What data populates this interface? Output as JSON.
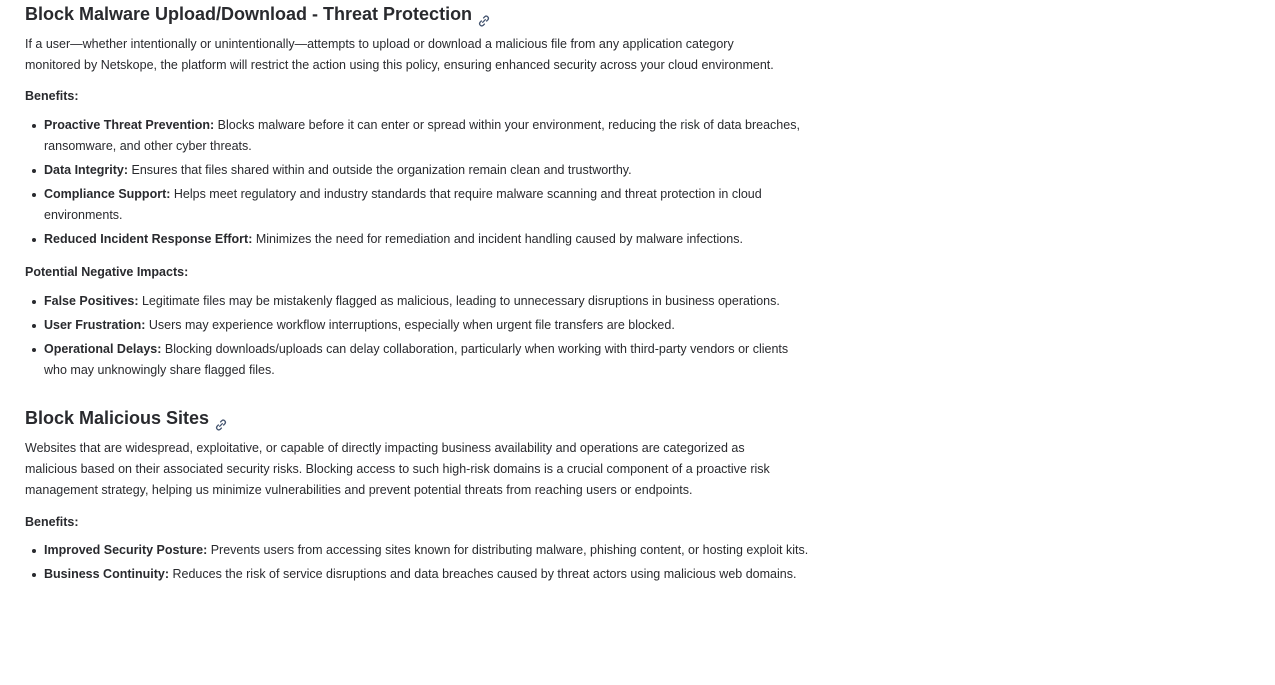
{
  "sections": [
    {
      "title": "Block Malware Upload/Download - Threat Protection",
      "description": "If a user—whether intentionally or unintentionally—attempts to upload or download a malicious file from any application category monitored by Netskope, the platform will  restrict the action using this policy, ensuring enhanced security across your cloud environment.",
      "benefits_label": "Benefits:",
      "benefits": [
        {
          "term": "Proactive Threat Prevention:",
          "text": " Blocks malware before it can enter or spread within your environment, reducing the risk of data breaches, ransomware, and other cyber threats."
        },
        {
          "term": "Data Integrity:",
          "text": " Ensures that files shared within and outside the organization remain clean and trustworthy."
        },
        {
          "term": "Compliance Support:",
          "text": " Helps meet regulatory and industry standards that require malware scanning and threat protection in cloud environments."
        },
        {
          "term": "Reduced Incident Response Effort:",
          "text": " Minimizes the need for remediation and incident handling caused by malware infections."
        }
      ],
      "negative_label": "Potential Negative Impacts:",
      "negatives": [
        {
          "term": "False Positives:",
          "text": " Legitimate files may be mistakenly flagged as malicious, leading to unnecessary disruptions in business operations."
        },
        {
          "term": "User Frustration:",
          "text": " Users may experience workflow interruptions, especially when urgent file transfers are blocked."
        },
        {
          "term": "Operational Delays:",
          "text": " Blocking downloads/uploads can delay collaboration, particularly when working with third-party vendors or clients who may unknowingly share flagged files."
        }
      ]
    },
    {
      "title": "Block Malicious Sites",
      "description": "Websites that are widespread, exploitative, or capable of directly impacting business availability and operations are categorized as malicious based on their associated security risks. Blocking access to such high-risk domains is a crucial component of a proactive risk management strategy, helping us minimize vulnerabilities and prevent potential threats from reaching users or endpoints.",
      "benefits_label": "Benefits:",
      "benefits": [
        {
          "term": "Improved Security Posture:",
          "text": " Prevents users from accessing sites known for distributing malware, phishing content, or hosting exploit kits."
        },
        {
          "term": "Business Continuity:",
          "text": " Reduces the risk of service disruptions and data breaches caused by threat actors using malicious web domains."
        }
      ]
    }
  ],
  "icons": {
    "heading_link": "link-icon"
  },
  "colors": {
    "text": "#292a2e",
    "background": "#ffffff"
  }
}
